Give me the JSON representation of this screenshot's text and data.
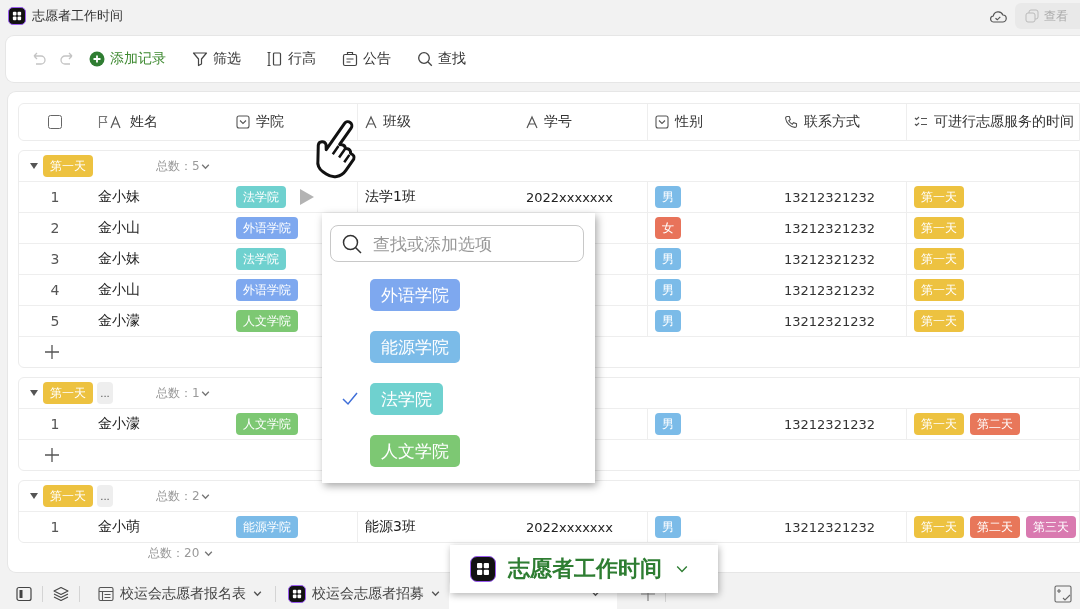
{
  "title_bar": {
    "title": "志愿者工作时间",
    "view_button": "查看"
  },
  "toolbar": [
    {
      "kind": "undo",
      "disabled": true
    },
    {
      "kind": "redo",
      "disabled": true
    },
    {
      "kind": "add",
      "label": "添加记录",
      "disabled": false
    },
    {
      "kind": "filter",
      "label": "筛选",
      "disabled": false
    },
    {
      "kind": "row_height",
      "label": "行高",
      "disabled": false
    },
    {
      "kind": "notice",
      "label": "公告",
      "disabled": false
    },
    {
      "kind": "search",
      "label": "查找",
      "disabled": false
    }
  ],
  "table": {
    "select_all": {
      "checked": false
    },
    "columns": [
      {
        "kind": "primary",
        "label": "姓名"
      },
      {
        "kind": "select",
        "label": "学院"
      },
      {
        "kind": "text",
        "label": "班级"
      },
      {
        "kind": "text",
        "label": "学号"
      },
      {
        "kind": "select",
        "label": "性别"
      },
      {
        "kind": "phone",
        "label": "联系方式"
      },
      {
        "kind": "multiselect",
        "label": "可进行志愿服务的时间"
      }
    ],
    "groups": [
      {
        "tag": {
          "label": "第一天",
          "color": "#edc240"
        },
        "count": "总数：5",
        "add_row": true,
        "rows": [
          {
            "index": "1",
            "name": "金小妹",
            "college": {
              "label": "法学院",
              "color": "#6fd1cf"
            },
            "expand_button": true,
            "class": "法学1班",
            "student_id": "2022xxxxxxx",
            "gender": {
              "label": "男",
              "color": "#7bbbe8"
            },
            "phone": "13212321232",
            "days": [
              {
                "label": "第一天",
                "color": "#edc240"
              }
            ]
          },
          {
            "index": "2",
            "name": "金小山",
            "college": {
              "label": "外语学院",
              "color": "#7ea8ef"
            },
            "expand_button": false,
            "gender": {
              "label": "女",
              "color": "#e8735a"
            },
            "phone": "13212321232",
            "days": [
              {
                "label": "第一天",
                "color": "#edc240"
              }
            ]
          },
          {
            "index": "3",
            "name": "金小妹",
            "college": {
              "label": "法学院",
              "color": "#6fd1cf"
            },
            "expand_button": false,
            "gender": {
              "label": "男",
              "color": "#7bbbe8"
            },
            "phone": "13212321232",
            "days": [
              {
                "label": "第一天",
                "color": "#edc240"
              }
            ]
          },
          {
            "index": "4",
            "name": "金小山",
            "college": {
              "label": "外语学院",
              "color": "#7ea8ef"
            },
            "expand_button": false,
            "gender": {
              "label": "男",
              "color": "#7bbbe8"
            },
            "phone": "13212321232",
            "days": [
              {
                "label": "第一天",
                "color": "#edc240"
              }
            ]
          },
          {
            "index": "5",
            "name": "金小濛",
            "college": {
              "label": "人文学院",
              "color": "#7dc873"
            },
            "expand_button": false,
            "gender": {
              "label": "男",
              "color": "#7bbbe8"
            },
            "phone": "13212321232",
            "days": [
              {
                "label": "第一天",
                "color": "#edc240"
              }
            ]
          }
        ]
      },
      {
        "tag": {
          "label": "第一天",
          "color": "#edc240"
        },
        "more": "...",
        "count": "总数：1",
        "add_row": true,
        "rows": [
          {
            "index": "1",
            "name": "金小濛",
            "college": {
              "label": "人文学院",
              "color": "#7dc873"
            },
            "expand_button": false,
            "gender": {
              "label": "男",
              "color": "#7bbbe8"
            },
            "phone": "13212321232",
            "days": [
              {
                "label": "第一天",
                "color": "#edc240"
              },
              {
                "label": "第二天",
                "color": "#e8775a"
              }
            ]
          }
        ]
      },
      {
        "tag": {
          "label": "第一天",
          "color": "#edc240"
        },
        "more": "...",
        "count": "总数：2",
        "add_row": false,
        "rows": [
          {
            "index": "1",
            "name": "金小萌",
            "college": {
              "label": "能源学院",
              "color": "#7bbbe8"
            },
            "expand_button": false,
            "class": "能源3班",
            "student_id": "2022xxxxxxx",
            "gender": {
              "label": "男",
              "color": "#7bbbe8"
            },
            "phone": "13212321232",
            "days": [
              {
                "label": "第一天",
                "color": "#edc240"
              },
              {
                "label": "第二天",
                "color": "#e8775a"
              },
              {
                "label": "第三天",
                "color": "#d97ab0"
              }
            ]
          }
        ]
      }
    ],
    "total": "总数：20"
  },
  "popup": {
    "placeholder": "查找或添加选项",
    "options": [
      {
        "label": "外语学院",
        "color": "#7ea8ef",
        "selected": false
      },
      {
        "label": "能源学院",
        "color": "#7bbbe8",
        "selected": false
      },
      {
        "label": "法学院",
        "color": "#6fd1cf",
        "selected": true
      },
      {
        "label": "人文学院",
        "color": "#7dc873",
        "selected": false
      }
    ]
  },
  "bottom_tabs": [
    {
      "kind": "table",
      "label": "校运会志愿者报名表",
      "selected": false
    },
    {
      "kind": "app",
      "label": "校运会志愿者招募",
      "selected": false
    },
    {
      "selected": true
    }
  ],
  "callout": {
    "label": "志愿者工作时间"
  }
}
